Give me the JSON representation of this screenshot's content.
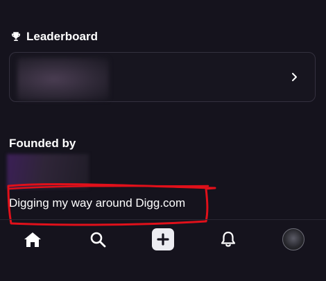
{
  "leaderboard": {
    "title": "Leaderboard",
    "icon": "trophy-icon",
    "chevron_icon": "chevron-right-icon"
  },
  "founded_by": {
    "title": "Founded by",
    "bio": "Digging my way around Digg.com"
  },
  "annotation": {
    "color": "#e0101a"
  },
  "bottom_nav": {
    "items": [
      {
        "name": "home",
        "icon": "home-icon"
      },
      {
        "name": "search",
        "icon": "search-icon"
      },
      {
        "name": "create",
        "icon": "plus-icon"
      },
      {
        "name": "notifications",
        "icon": "bell-icon"
      },
      {
        "name": "profile",
        "icon": "avatar"
      }
    ]
  }
}
